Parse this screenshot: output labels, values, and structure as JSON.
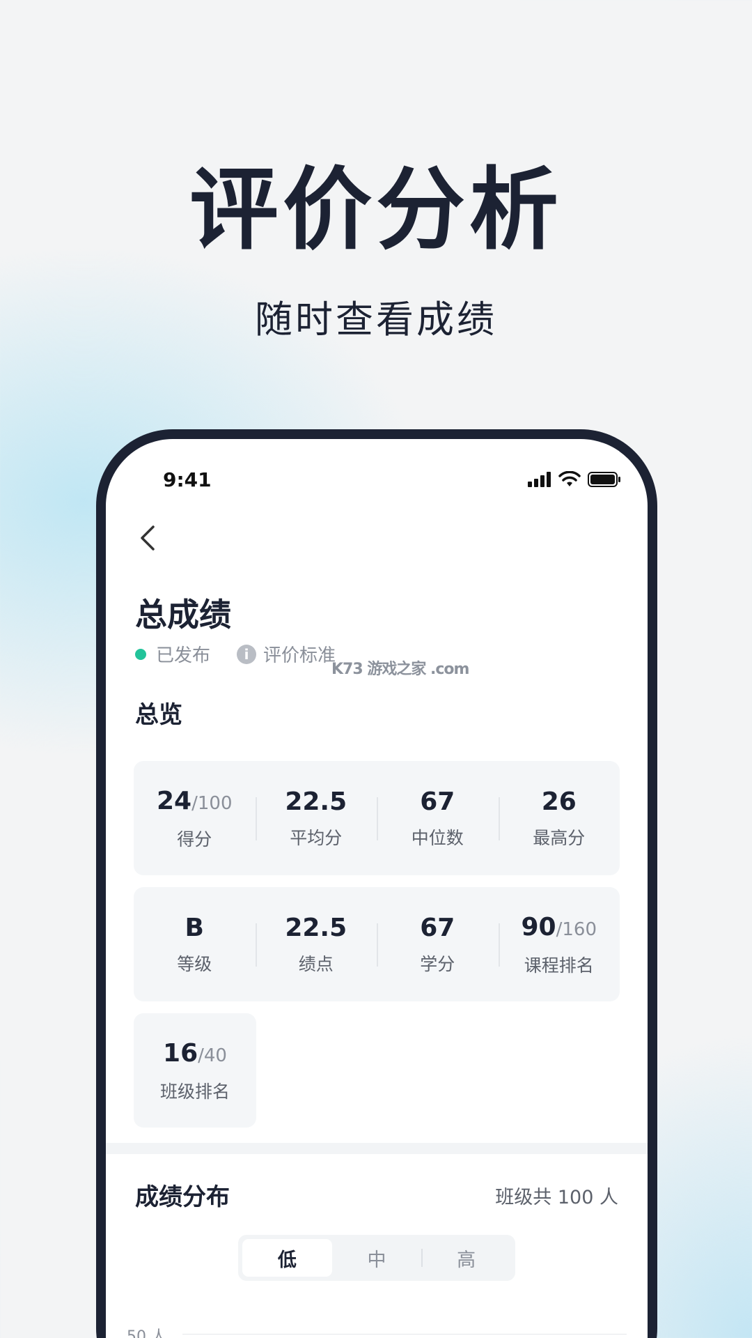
{
  "hero": {
    "title": "评价分析",
    "subtitle": "随时查看成绩"
  },
  "status_bar": {
    "time": "9:41",
    "icons": [
      "signal-icon",
      "wifi-icon",
      "battery-icon"
    ]
  },
  "nav": {
    "back_icon": "chevron-left-icon"
  },
  "page": {
    "title": "总成绩",
    "status": "已发布",
    "criteria_link": "评价标准",
    "watermark": "K73 游戏之家 .com"
  },
  "overview": {
    "title": "总览",
    "row1": [
      {
        "value": "24",
        "suffix": "/100",
        "label": "得分"
      },
      {
        "value": "22.5",
        "suffix": "",
        "label": "平均分"
      },
      {
        "value": "67",
        "suffix": "",
        "label": "中位数"
      },
      {
        "value": "26",
        "suffix": "",
        "label": "最高分"
      }
    ],
    "row2": [
      {
        "value": "B",
        "suffix": "",
        "label": "等级"
      },
      {
        "value": "22.5",
        "suffix": "",
        "label": "绩点"
      },
      {
        "value": "67",
        "suffix": "",
        "label": "学分"
      },
      {
        "value": "90",
        "suffix": "/160",
        "label": "课程排名"
      }
    ],
    "row3": [
      {
        "value": "16",
        "suffix": "/40",
        "label": "班级排名"
      }
    ]
  },
  "distribution": {
    "title": "成绩分布",
    "class_total": "班级共 100 人",
    "tabs": [
      "低",
      "中",
      "高"
    ],
    "active_tab": "低",
    "y_top_label": "50 人"
  },
  "colors": {
    "dark": "#1c2233",
    "published_dot": "#22c39a",
    "card_bg": "#f4f6f8"
  }
}
